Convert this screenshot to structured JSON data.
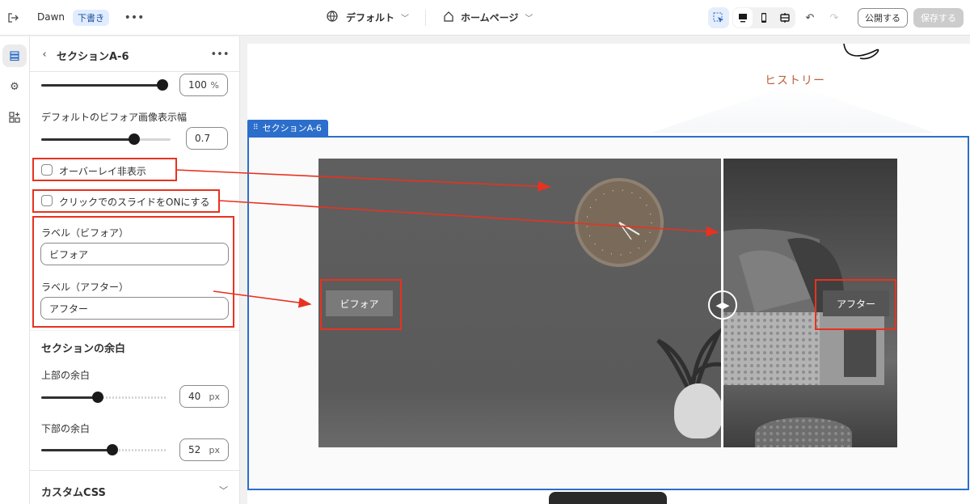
{
  "topbar": {
    "theme_name": "Dawn",
    "draft_badge": "下書き",
    "template_label": "デフォルト",
    "page_label": "ホームページ",
    "publish_label": "公開する",
    "save_label": "保存する"
  },
  "panel": {
    "title": "セクションA-6",
    "opacity_value": "100",
    "opacity_unit": "%",
    "opacity_level": 1.0,
    "before_width_label": "デフォルトのビフォア画像表示幅",
    "before_width_value": "0.7",
    "before_width_level": 0.72,
    "overlay_label": "オーバーレイ非表示",
    "click_slide_label": "クリックでのスライドをONにする",
    "before_label_title": "ラベル（ビフォア）",
    "before_label_value": "ビフォア",
    "after_label_title": "ラベル（アフター）",
    "after_label_value": "アフター",
    "spacing_heading": "セクションの余白",
    "top_spacing_label": "上部の余白",
    "top_spacing_value": "40",
    "top_spacing_level": 0.43,
    "bottom_spacing_label": "下部の余白",
    "bottom_spacing_value": "52",
    "bottom_spacing_level": 0.56,
    "spacing_unit": "px",
    "custom_css_label": "カスタムCSS"
  },
  "preview": {
    "history_text": "ヒストリー",
    "section_tag": "セクションA-6",
    "before_badge": "ビフォア",
    "after_badge": "アフター"
  },
  "colors": {
    "accent_blue": "#2c6ecb",
    "annotation_red": "#e8321f",
    "history_text": "#c0603a"
  }
}
